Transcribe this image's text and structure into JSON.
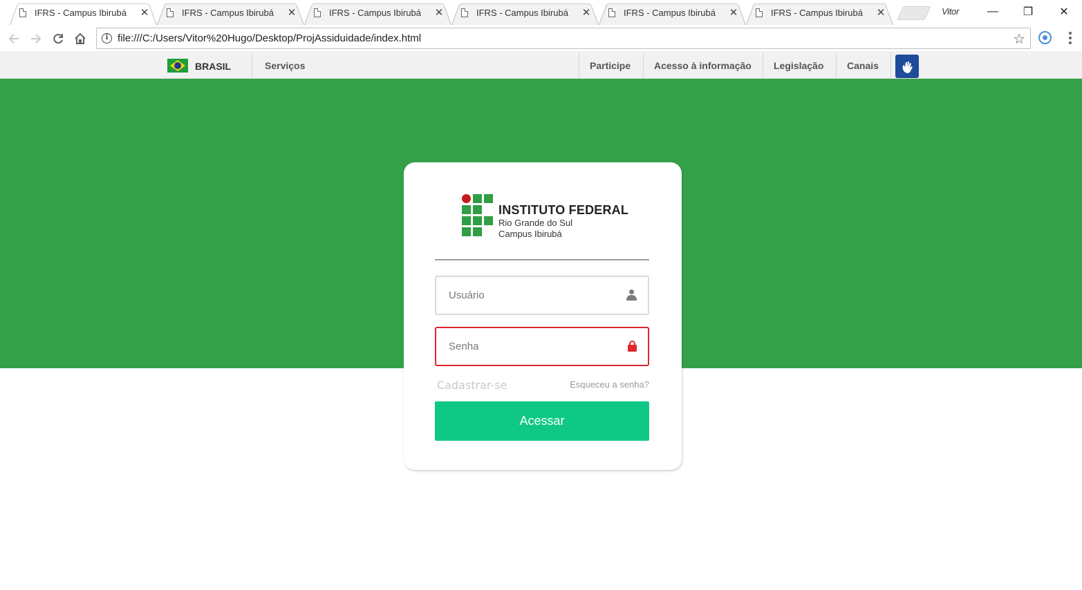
{
  "browser": {
    "tabs": [
      {
        "title": "IFRS - Campus Ibirubá",
        "active": true
      },
      {
        "title": "IFRS - Campus Ibirubá",
        "active": false
      },
      {
        "title": "IFRS - Campus Ibirubá",
        "active": false
      },
      {
        "title": "IFRS - Campus Ibirubá",
        "active": false
      },
      {
        "title": "IFRS - Campus Ibirubá",
        "active": false
      },
      {
        "title": "IFRS - Campus Ibirubá",
        "active": false
      }
    ],
    "close_glyph": "✕",
    "profile_name": "Vitor",
    "window_controls": {
      "minimize": "—",
      "restore": "❐",
      "close": "✕"
    },
    "url": "file:///C:/Users/Vitor%20Hugo/Desktop/ProjAssiduidade/index.html",
    "icons": [
      "back-icon",
      "forward-icon",
      "reload-icon",
      "home-icon",
      "info-icon",
      "star-icon",
      "extension-icon",
      "menu-icon"
    ]
  },
  "govbar": {
    "country": "BRASIL",
    "services": "Serviços",
    "links": [
      "Participe",
      "Acesso à informação",
      "Legislação",
      "Canais"
    ],
    "accessibility_icon": "vlibras-icon"
  },
  "login": {
    "logo": {
      "title": "INSTITUTO FEDERAL",
      "line1": "Rio Grande do Sul",
      "line2": "Campus Ibirubá"
    },
    "username_placeholder": "Usuário",
    "password_placeholder": "Senha",
    "register_link": "Cadastrar-se",
    "forgot_link": "Esqueceu a senha?",
    "submit_label": "Acessar"
  },
  "colors": {
    "hero_green": "#34a148",
    "button_green": "#0fc885",
    "error_red": "#e0262f",
    "logo_red": "#c8191f",
    "logo_green": "#2f9e44",
    "gov_blue": "#1f4c9a"
  }
}
